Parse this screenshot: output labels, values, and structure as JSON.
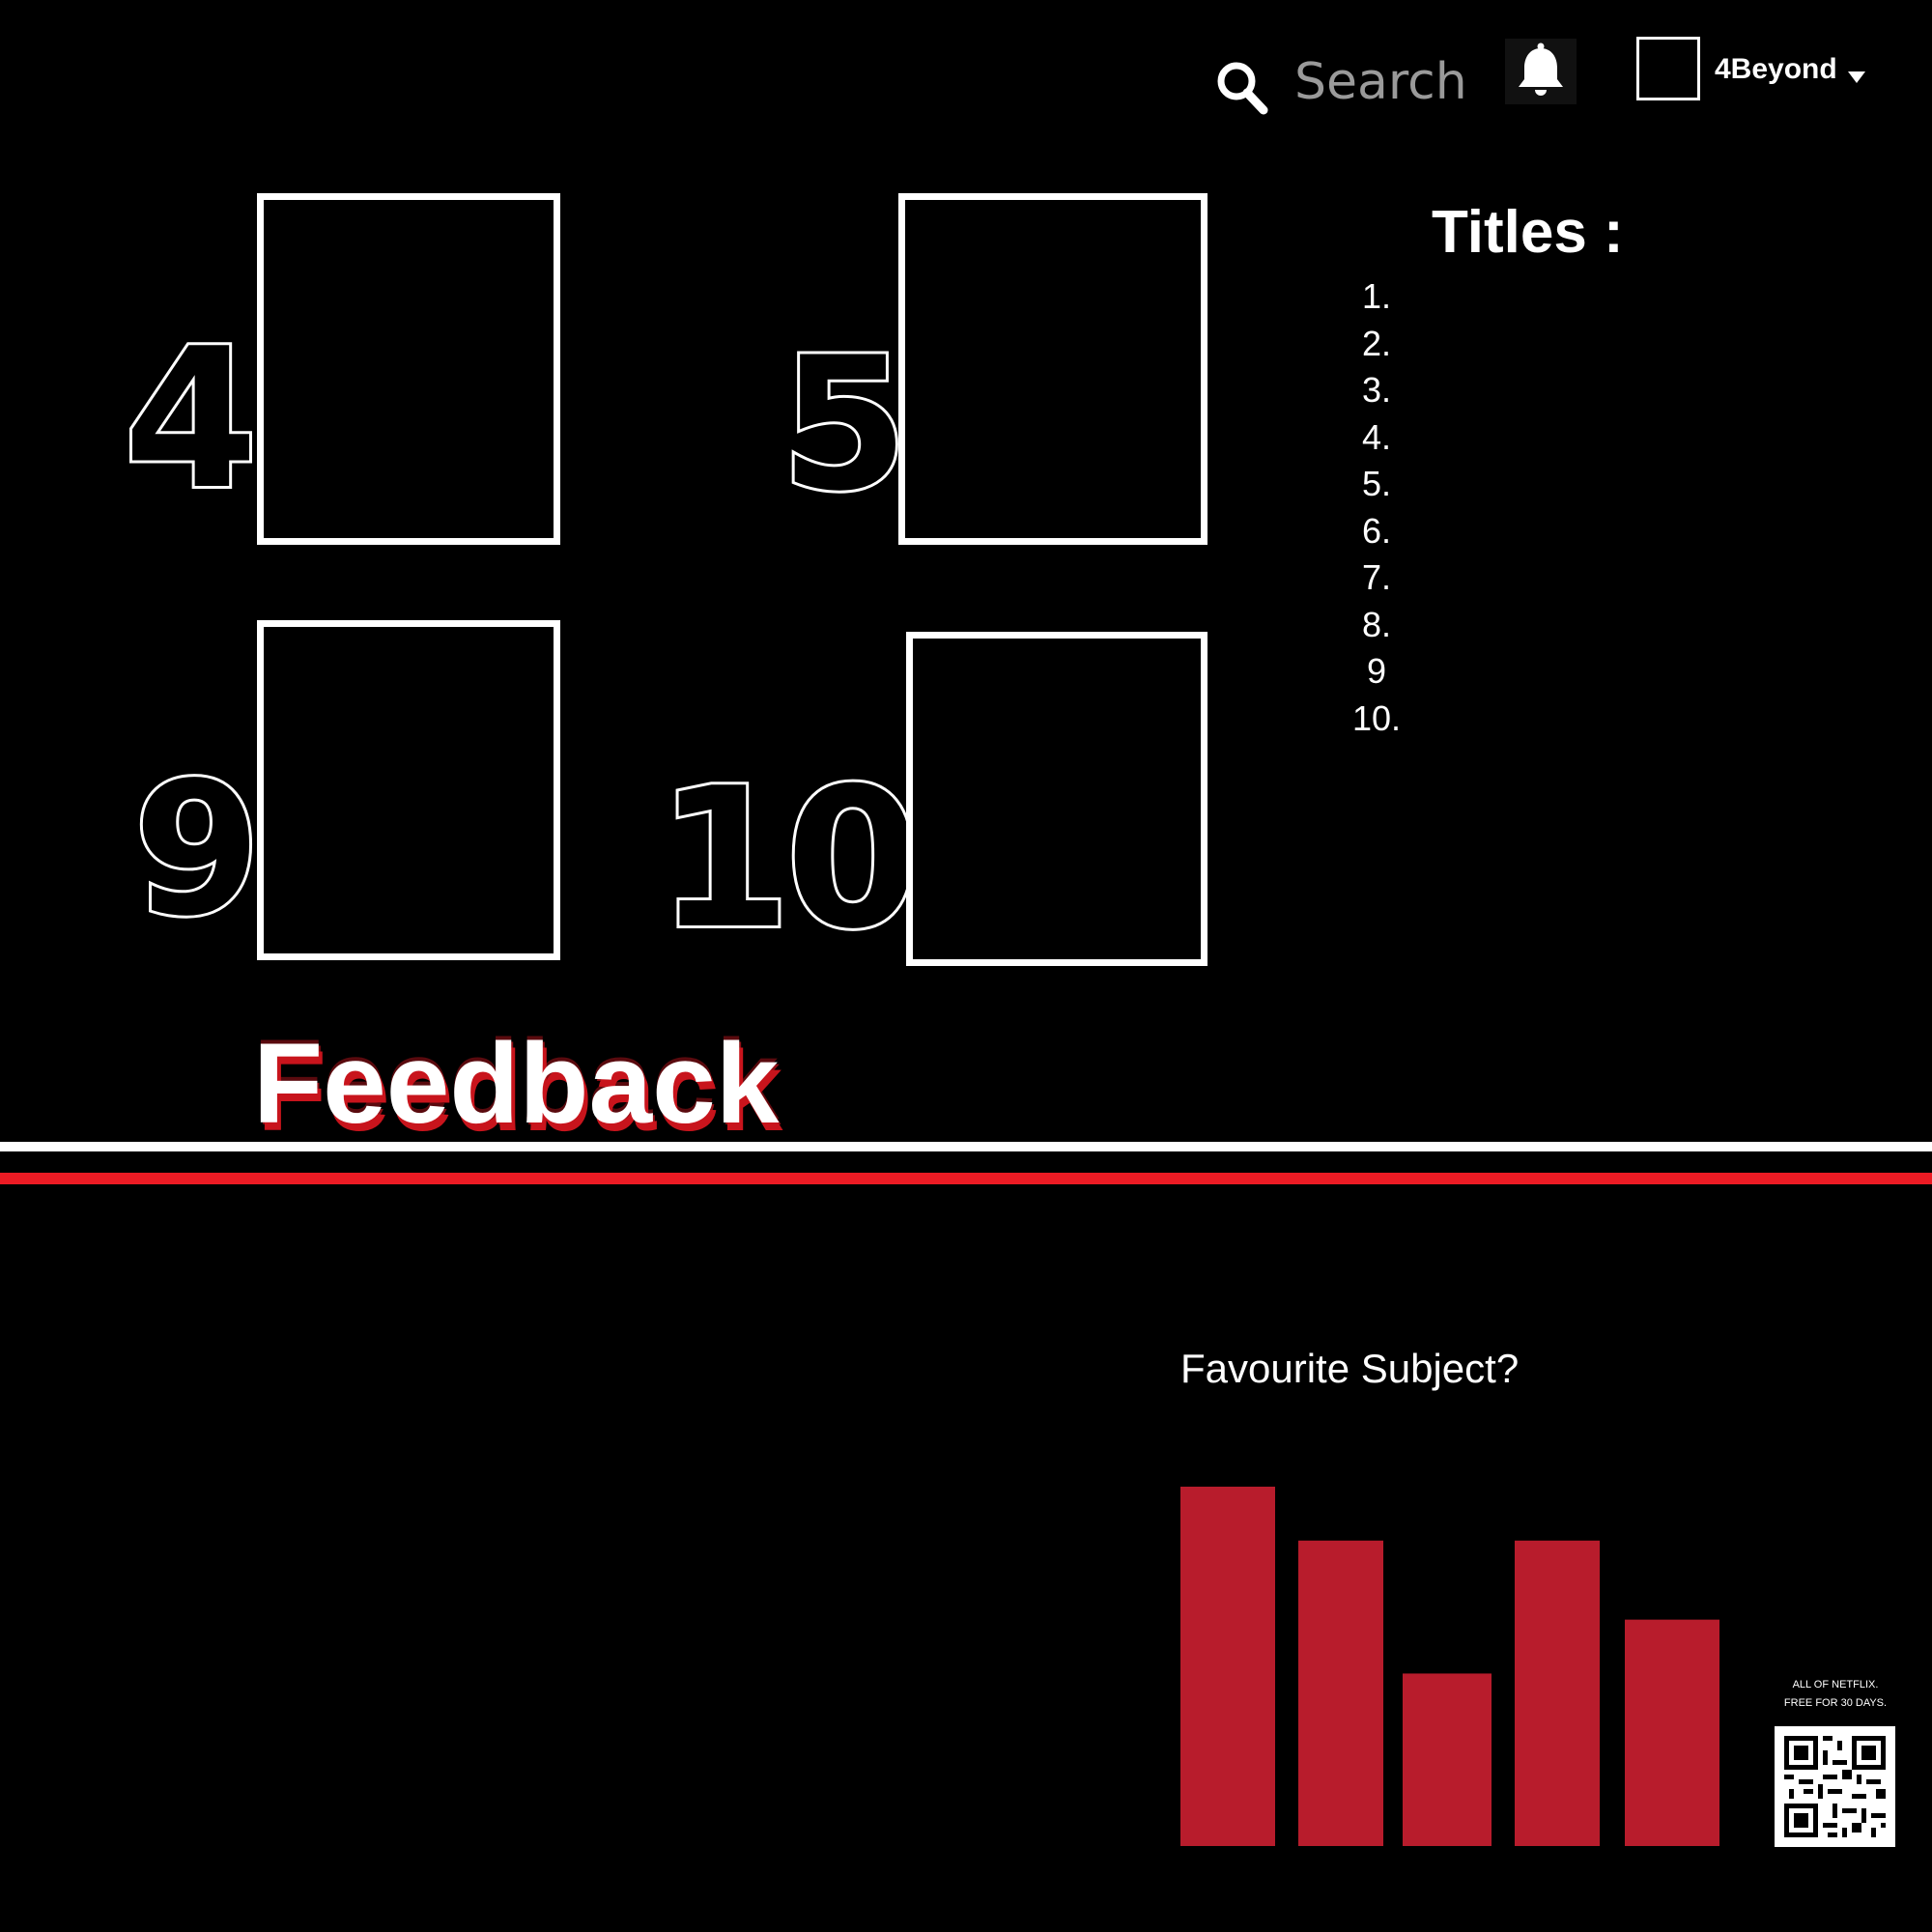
{
  "header": {
    "search": {
      "placeholder": "Search",
      "icon": "search-icon"
    },
    "notifications_icon": "bell-icon",
    "user": {
      "name": "4Beyond",
      "caret_icon": "caret-down-icon"
    }
  },
  "top_ten": {
    "items": [
      {
        "rank": "4"
      },
      {
        "rank": "5"
      },
      {
        "rank": "9"
      },
      {
        "rank": "10"
      }
    ]
  },
  "titles": {
    "heading": "Titles :",
    "items": [
      "1.",
      "2.",
      "3.",
      "4.",
      "5.",
      "6.",
      "7.",
      "8.",
      "9",
      "10."
    ]
  },
  "feedback": {
    "heading": "Feedback"
  },
  "colors": {
    "background": "#000000",
    "accent_red": "#ec1b24",
    "bar_red": "#b81c2c",
    "text": "#ffffff"
  },
  "chart_data": {
    "type": "bar",
    "title": "Favourite Subject?",
    "categories": [],
    "values": [
      100,
      85,
      48,
      85,
      63
    ],
    "xlabel": "",
    "ylabel": "",
    "ylim": [
      0,
      100
    ],
    "grid": false
  },
  "promo": {
    "line1": "ALL OF NETFLIX.",
    "line2": "FREE FOR 30 DAYS.",
    "qr_icon": "qr-code-icon"
  }
}
